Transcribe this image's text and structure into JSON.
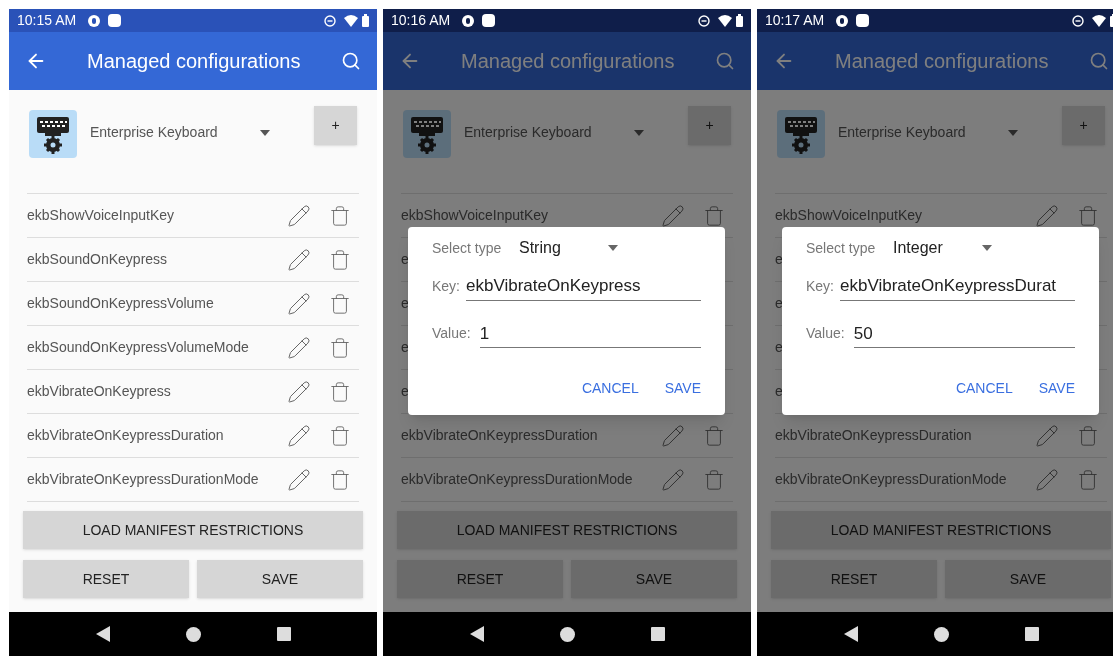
{
  "phones": [
    {
      "time": "10:15 AM",
      "title": "Managed configurations",
      "app_name": "Enterprise Keyboard",
      "add_label": "+",
      "rows": [
        {
          "text": "ekbShowVoiceInputKey"
        },
        {
          "text": "ekbSoundOnKeypress"
        },
        {
          "text": "ekbSoundOnKeypressVolume"
        },
        {
          "text": "ekbSoundOnKeypressVolumeMode"
        },
        {
          "text": "ekbVibrateOnKeypress"
        },
        {
          "text": "ekbVibrateOnKeypressDuration"
        },
        {
          "text": "ekbVibrateOnKeypressDurationMode"
        }
      ],
      "load_label": "LOAD MANIFEST RESTRICTIONS",
      "reset_label": "RESET",
      "save_label": "SAVE"
    },
    {
      "time": "10:16 AM",
      "title": "Managed configurations",
      "app_name": "Enterprise Keyboard",
      "add_label": "+",
      "rows": [
        {
          "text": "ekbShowVoiceInputKey"
        },
        {
          "text": "e"
        },
        {
          "text": "e"
        },
        {
          "text": "e"
        },
        {
          "text": "e"
        },
        {
          "text": "ekbVibrateOnKeypressDuration"
        },
        {
          "text": "ekbVibrateOnKeypressDurationMode"
        }
      ],
      "load_label": "LOAD MANIFEST RESTRICTIONS",
      "reset_label": "RESET",
      "save_label": "SAVE",
      "dialog": {
        "select_label": "Select type",
        "select_value": "String",
        "key_label": "Key:",
        "key_value": "ekbVibrateOnKeypress",
        "value_label": "Value:",
        "value_value": "1",
        "cancel_label": "CANCEL",
        "save_label": "SAVE"
      }
    },
    {
      "time": "10:17 AM",
      "title": "Managed configurations",
      "app_name": "Enterprise Keyboard",
      "add_label": "+",
      "rows": [
        {
          "text": "ekbShowVoiceInputKey"
        },
        {
          "text": "e"
        },
        {
          "text": "e"
        },
        {
          "text": "e"
        },
        {
          "text": "e"
        },
        {
          "text": "ekbVibrateOnKeypressDuration"
        },
        {
          "text": "ekbVibrateOnKeypressDurationMode"
        }
      ],
      "load_label": "LOAD MANIFEST RESTRICTIONS",
      "reset_label": "RESET",
      "save_label": "SAVE",
      "dialog": {
        "select_label": "Select type",
        "select_value": "Integer",
        "key_label": "Key:",
        "key_value": "ekbVibrateOnKeypressDurat",
        "value_label": "Value:",
        "value_value": "50",
        "cancel_label": "CANCEL",
        "save_label": "SAVE"
      }
    }
  ]
}
